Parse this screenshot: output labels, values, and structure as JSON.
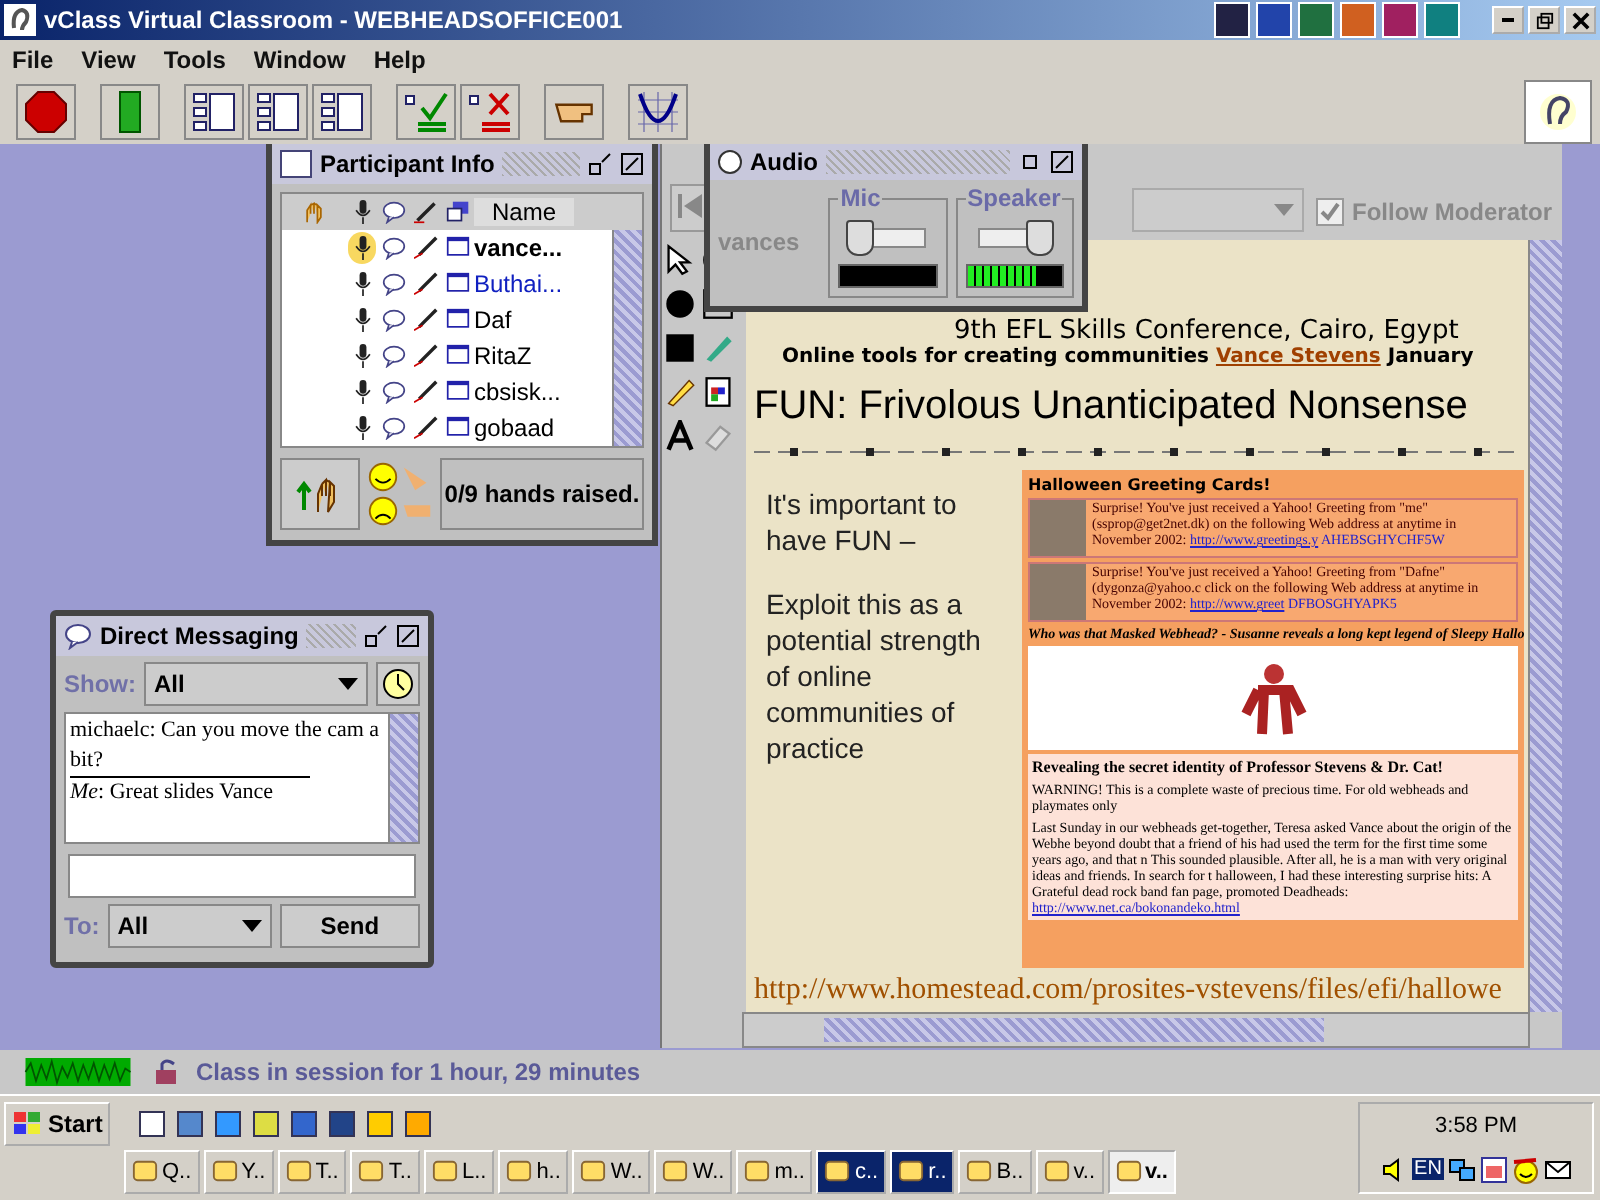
{
  "window": {
    "title": "vClass Virtual Classroom - WEBHEADSOFFICE001"
  },
  "menu": [
    "File",
    "View",
    "Tools",
    "Window",
    "Help"
  ],
  "participant_info": {
    "title": "Participant Info",
    "column_name": "Name",
    "hands_raised": "0/9 hands raised.",
    "participants": [
      {
        "name": "vance...",
        "kind": "moderator",
        "talking": true
      },
      {
        "name": "Buthai...",
        "kind": "highlighted",
        "talking": false
      },
      {
        "name": "Daf",
        "kind": "plain",
        "talking": false
      },
      {
        "name": "RitaZ",
        "kind": "plain",
        "talking": false
      },
      {
        "name": "cbsisk...",
        "kind": "plain",
        "talking": false
      },
      {
        "name": "gobaad",
        "kind": "plain",
        "talking": false
      }
    ]
  },
  "audio": {
    "title": "Audio",
    "user": "vances",
    "channels": [
      {
        "label": "Mic",
        "slider": {
          "level": 0.05
        },
        "meter": {
          "level": 0
        }
      },
      {
        "label": "Speaker",
        "slider": {
          "level": 0.9
        },
        "meter": {
          "level": 0.72
        }
      }
    ]
  },
  "whiteboard": {
    "follow_moderator": {
      "label": "Follow Moderator",
      "checked": true,
      "disabled": true
    },
    "slide": {
      "conference": "9th EFL Skills Conference, Cairo, Egypt",
      "subtitle": "Online tools for creating communities",
      "author": "Vance Stevens",
      "date": "January",
      "heading": "FUN: Frivolous Unanticipated Nonsense",
      "points": [
        "It's important to have FUN –",
        "Exploit this as a potential strength of online communities of practice"
      ],
      "webpage": {
        "title": "Halloween Greeting Cards!",
        "cards": [
          {
            "text": "Surprise! You've just received a Yahoo! Greeting from \"me\" (ssprop@get2net.dk) on the following Web address at anytime in November 2002:",
            "link": "http://www.greetings.y",
            "code": "AHEBSGHYCHF5W"
          },
          {
            "text": "Surprise! You've just received a Yahoo! Greeting from \"Dafne\" (dygonza@yahoo.c click on the following Web address at anytime in November 2002:",
            "link": "http://www.greet",
            "code": "DFBOSGHYAPK5"
          }
        ],
        "caption": "Who was that Masked Webhead? - Susanne reveals a long kept legend of Sleepy Hallo",
        "article_title": "Revealing the secret identity of Professor Stevens & Dr. Cat!",
        "warning": "WARNING! This is a complete waste of precious time. For old webheads and playmates only",
        "article": "Last Sunday in our webheads get-together, Teresa asked Vance about the origin of the Webhe beyond doubt that a friend of his had used the term for the first time some years ago, and that n This sounded plausible. After all, he is a man with very original ideas and friends. In search for t halloween, I had these interesting surprise hits: A Grateful dead rock band fan page, promoted Deadheads:",
        "article_link": "http://www.net.ca/bokonandeko.html"
      },
      "url": "http://www.homestead.com/prosites-vstevens/files/efi/hallowe"
    }
  },
  "direct_messaging": {
    "title": "Direct Messaging",
    "show_label": "Show:",
    "show_value": "All",
    "messages": [
      "michaelc: Can you move the cam a bit?",
      "*Me*: Great slides Vance"
    ],
    "to_label": "To:",
    "to_value": "All",
    "send": "Send"
  },
  "status_bar": {
    "session": "Class in session for 1 hour, 29 minutes"
  },
  "taskbar": {
    "start": "Start",
    "tasks": [
      {
        "label": "Q..",
        "selected": false,
        "flashing": false
      },
      {
        "label": "Y..",
        "selected": false,
        "flashing": false
      },
      {
        "label": "T..",
        "selected": false,
        "flashing": false
      },
      {
        "label": "T..",
        "selected": false,
        "flashing": false
      },
      {
        "label": "L..",
        "selected": false,
        "flashing": false
      },
      {
        "label": "h..",
        "selected": false,
        "flashing": false
      },
      {
        "label": "W..",
        "selected": false,
        "flashing": false
      },
      {
        "label": "W..",
        "selected": false,
        "flashing": false
      },
      {
        "label": "m..",
        "selected": false,
        "flashing": false
      },
      {
        "label": "c..",
        "selected": false,
        "flashing": true
      },
      {
        "label": "r..",
        "selected": false,
        "flashing": true
      },
      {
        "label": "B..",
        "selected": false,
        "flashing": false
      },
      {
        "label": "v..",
        "selected": false,
        "flashing": false
      },
      {
        "label": "v..",
        "selected": true,
        "flashing": false
      }
    ],
    "clock": "3:58 PM",
    "language": "EN"
  }
}
